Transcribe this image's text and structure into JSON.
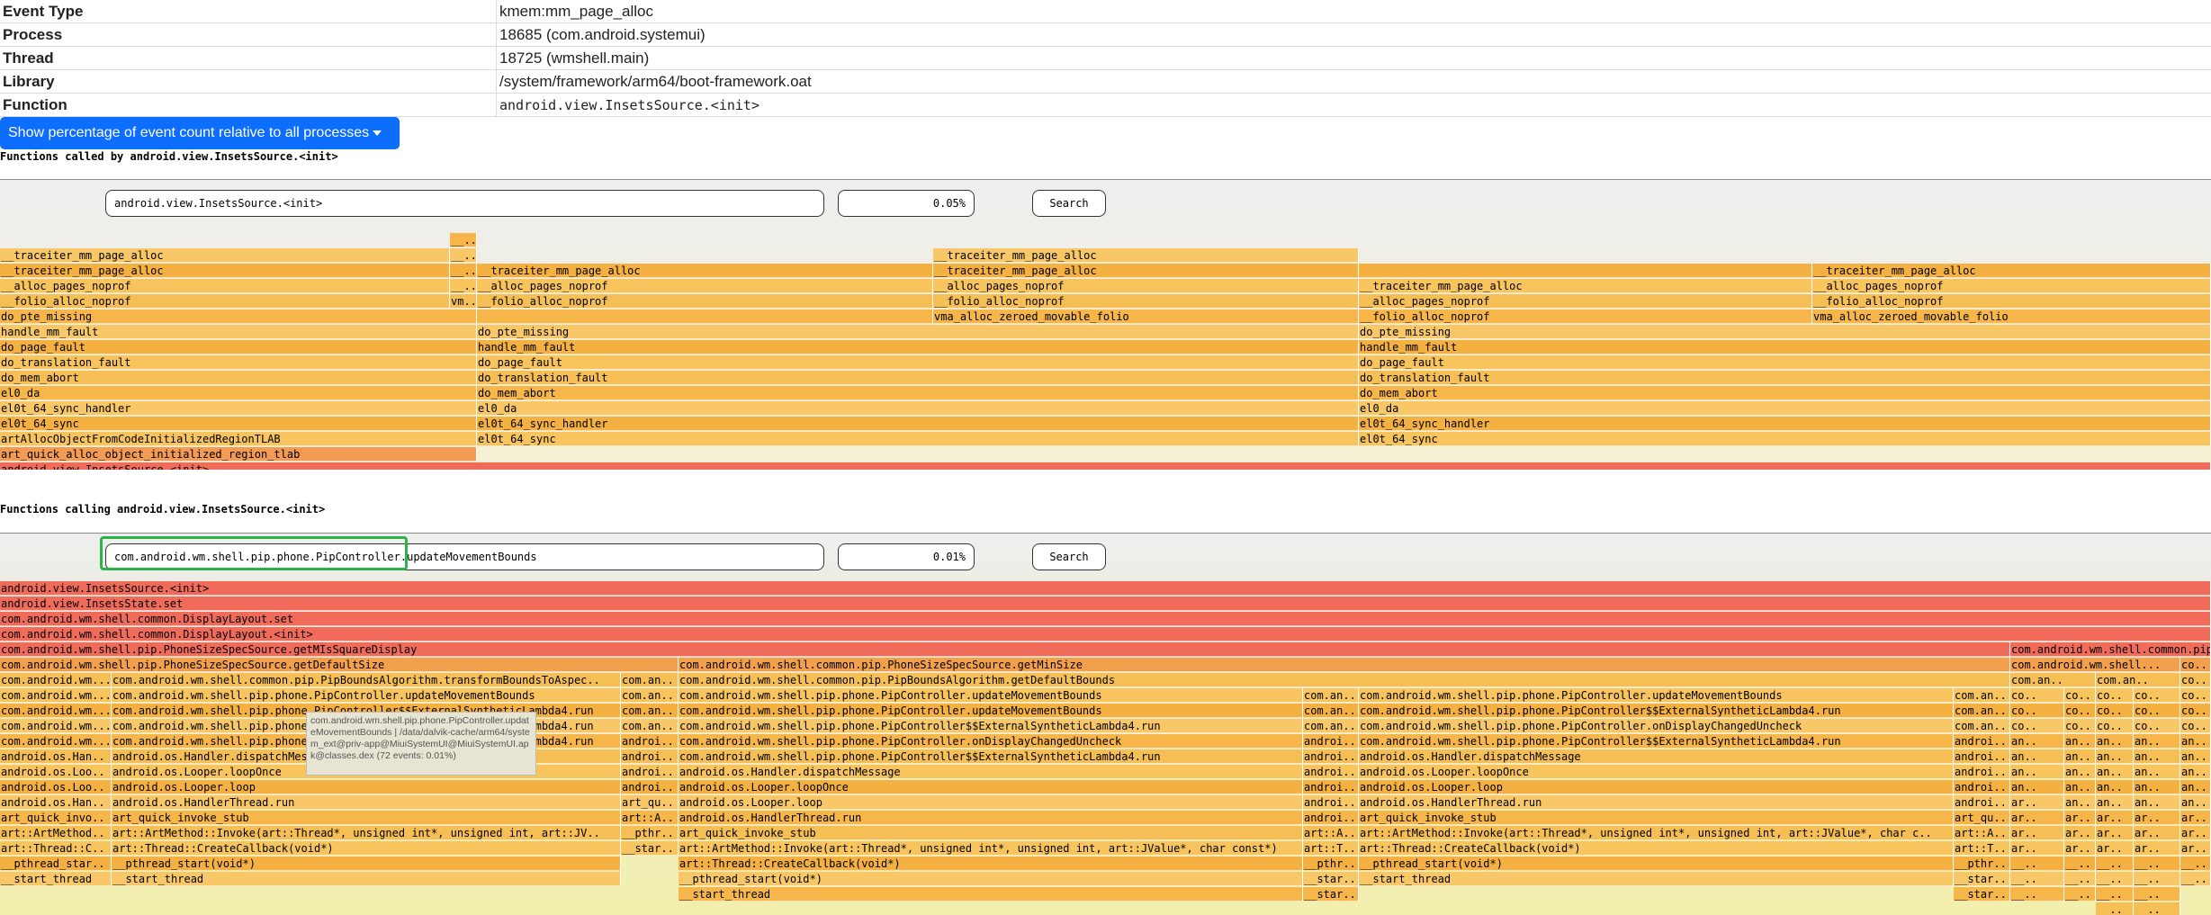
{
  "info": [
    {
      "label": "Event Type",
      "value": "kmem:mm_page_alloc"
    },
    {
      "label": "Process",
      "value": "18685 (com.android.systemui)"
    },
    {
      "label": "Thread",
      "value": "18725 (wmshell.main)"
    },
    {
      "label": "Library",
      "value": "/system/framework/arm64/boot-framework.oat"
    },
    {
      "label": "Function",
      "value": "android.view.InsetsSource.<init>"
    }
  ],
  "toggle_button": "Show percentage of event count relative to all processes",
  "callee": {
    "header": "Functions called by android.view.InsetsSource.<init>",
    "search_value": "android.view.InsetsSource.<init>",
    "percent": "0.05%",
    "search_label": "Search"
  },
  "caller": {
    "header": "Functions calling android.view.InsetsSource.<init>",
    "search_value": "com.android.wm.shell.pip.phone.PipController.updateMovementBounds",
    "percent": "0.01%",
    "search_label": "Search"
  },
  "colors": {
    "accent": "#0d6efd",
    "hot": "#f16b5b",
    "warm": "#f5b041",
    "highlight": "#2eb34a"
  },
  "tooltip": "com.android.wm.shell.pip.phone.PipController.updateMovementBounds | /data/dalvik-cache/arm64/system_ext@priv-app@MiuiSystemUI@MiuiSystemUI.apk@classes.dex (72 events: 0.01%)",
  "flame_top": [
    [
      0,
      1,
      "android.view.InsetsSource.<init>",
      0
    ],
    [
      0,
      0.2156,
      "art_quick_alloc_object_initialized_region_tlab",
      1
    ],
    [
      0.6145,
      1,
      "",
      2
    ],
    [
      0,
      0.2156,
      "artAllocObjectFromCodeInitializedRegionTLAB",
      2
    ],
    [
      0.2156,
      0.6145,
      "el0t_64_sync",
      2
    ],
    [
      0.6145,
      1,
      "el0t_64_sync",
      2
    ],
    [
      0,
      0.2156,
      "el0t_64_sync",
      3
    ],
    [
      0.2156,
      0.6145,
      "el0t_64_sync_handler",
      3
    ],
    [
      0.6145,
      1,
      "el0t_64_sync_handler",
      3
    ],
    [
      0,
      0.2156,
      "el0t_64_sync_handler",
      4
    ],
    [
      0.2156,
      0.6145,
      "el0_da",
      4
    ],
    [
      0.6145,
      1,
      "el0_da",
      4
    ],
    [
      0,
      0.2156,
      "el0_da",
      5
    ],
    [
      0.2156,
      0.6145,
      "do_mem_abort",
      5
    ],
    [
      0.6145,
      1,
      "do_mem_abort",
      5
    ],
    [
      0,
      0.2156,
      "do_mem_abort",
      6
    ],
    [
      0.2156,
      0.6145,
      "do_translation_fault",
      6
    ],
    [
      0.6145,
      1,
      "do_translation_fault",
      6
    ],
    [
      0,
      0.2156,
      "do_translation_fault",
      7
    ],
    [
      0.2156,
      0.6145,
      "do_page_fault",
      7
    ],
    [
      0.6145,
      1,
      "do_page_fault",
      7
    ],
    [
      0,
      0.2156,
      "do_page_fault",
      8
    ],
    [
      0.2156,
      0.6145,
      "handle_mm_fault",
      8
    ],
    [
      0.6145,
      1,
      "handle_mm_fault",
      8
    ],
    [
      0,
      0.2156,
      "handle_mm_fault",
      9
    ],
    [
      0.2156,
      0.6145,
      "do_pte_missing",
      9
    ],
    [
      0.6145,
      1,
      "do_pte_missing",
      9
    ],
    [
      0,
      0.2156,
      "do_pte_missing",
      10
    ],
    [
      0.2156,
      0.4219,
      "",
      10
    ],
    [
      0.4219,
      0.6145,
      "vma_alloc_zeroed_movable_folio",
      10
    ],
    [
      0.6145,
      0.8197,
      "__folio_alloc_noprof",
      10
    ],
    [
      0.8197,
      1,
      "vma_alloc_zeroed_movable_folio",
      10
    ],
    [
      0,
      0.2036,
      "__folio_alloc_noprof",
      11
    ],
    [
      0.2036,
      0.2156,
      "vm..",
      11
    ],
    [
      0.2156,
      0.4219,
      "__folio_alloc_noprof",
      11
    ],
    [
      0.4219,
      0.6145,
      "__folio_alloc_noprof",
      11
    ],
    [
      0.6145,
      0.8197,
      "__alloc_pages_noprof",
      11
    ],
    [
      0.8197,
      1,
      "__folio_alloc_noprof",
      11
    ],
    [
      0,
      0.2036,
      "__alloc_pages_noprof",
      12
    ],
    [
      0.2036,
      0.2156,
      "__..",
      12
    ],
    [
      0.2156,
      0.4219,
      "__alloc_pages_noprof",
      12
    ],
    [
      0.4219,
      0.6145,
      "__alloc_pages_noprof",
      12
    ],
    [
      0.6145,
      0.8197,
      "__traceiter_mm_page_alloc",
      12
    ],
    [
      0.8197,
      1,
      "__alloc_pages_noprof",
      12
    ],
    [
      0,
      0.2036,
      "__traceiter_mm_page_alloc",
      13
    ],
    [
      0.2036,
      0.2156,
      "__..",
      13
    ],
    [
      0.2156,
      0.4219,
      "__traceiter_mm_page_alloc",
      13
    ],
    [
      0.4219,
      0.6145,
      "__traceiter_mm_page_alloc",
      13
    ],
    [
      0.6145,
      0.8197,
      "",
      13
    ],
    [
      0.8197,
      1,
      "__traceiter_mm_page_alloc",
      13
    ],
    [
      0,
      0.2036,
      "__traceiter_mm_page_alloc",
      14
    ],
    [
      0.2036,
      0.2156,
      "__..",
      14
    ],
    [
      0.4219,
      0.6145,
      "__traceiter_mm_page_alloc",
      14
    ],
    [
      0.2036,
      0.2156,
      "__..",
      15
    ]
  ],
  "flame_bottom": [
    [
      0,
      1,
      "android.view.InsetsSource.<init>",
      0
    ],
    [
      0,
      1,
      "android.view.InsetsState.set",
      1
    ],
    [
      0,
      1,
      "com.android.wm.shell.common.DisplayLayout.set",
      2
    ],
    [
      0,
      1,
      "com.android.wm.shell.common.DisplayLayout.<init>",
      3
    ],
    [
      0,
      0.9091,
      "com.android.wm.shell.pip.PhoneSizeSpecSource.getMIsSquareDisplay",
      4
    ],
    [
      0.9091,
      1,
      "com.android.wm.shell.common.pip..",
      4
    ],
    [
      0,
      0.3068,
      "com.android.wm.shell.pip.PhoneSizeSpecSource.getDefaultSize",
      5
    ],
    [
      0.3068,
      0.9091,
      "com.android.wm.shell.common.pip.PhoneSizeSpecSource.getMinSize",
      5
    ],
    [
      0.9091,
      0.986,
      "com.android.wm.shell...",
      5
    ],
    [
      0.986,
      1,
      "co..",
      5
    ],
    [
      0,
      0.0505,
      "com.android.wm...",
      6
    ],
    [
      0.0505,
      0.281,
      "com.android.wm.shell.common.pip.PipBoundsAlgorithm.transformBoundsToAspec..",
      6
    ],
    [
      0.281,
      0.3068,
      "com.an..",
      6
    ],
    [
      0.3068,
      0.9091,
      "com.android.wm.shell.common.pip.PipBoundsAlgorithm.getDefaultBounds",
      6
    ],
    [
      0.9091,
      0.9478,
      "com.an..",
      6
    ],
    [
      0.9478,
      0.986,
      "com.an..",
      6
    ],
    [
      0.986,
      1,
      "co..",
      6
    ],
    [
      0,
      0.0505,
      "com.android.wm...",
      7
    ],
    [
      0.0505,
      0.281,
      "com.android.wm.shell.pip.phone.PipController.updateMovementBounds",
      7
    ],
    [
      0.281,
      0.3068,
      "com.an..",
      7
    ],
    [
      0.3068,
      0.5893,
      "com.android.wm.shell.pip.phone.PipController.updateMovementBounds",
      7
    ],
    [
      0.5893,
      0.6145,
      "com.an..",
      7
    ],
    [
      0.6145,
      0.8835,
      "com.android.wm.shell.pip.phone.PipController.updateMovementBounds",
      7
    ],
    [
      0.8835,
      0.9091,
      "com.an..",
      7
    ],
    [
      0.9091,
      0.9337,
      "co..",
      7
    ],
    [
      0.9337,
      0.9478,
      "co..",
      7
    ],
    [
      0.9478,
      0.9652,
      "co..",
      7
    ],
    [
      0.9652,
      0.986,
      "co..",
      7
    ],
    [
      0.986,
      1,
      "co..",
      7
    ],
    [
      0,
      0.0505,
      "com.android.wm...",
      8
    ],
    [
      0.0505,
      0.281,
      "com.android.wm.shell.pip.phone.PipController$$ExternalSyntheticLambda4.run",
      8
    ],
    [
      0.281,
      0.3068,
      "com.an..",
      8
    ],
    [
      0.3068,
      0.5893,
      "com.android.wm.shell.pip.phone.PipController.updateMovementBounds",
      8
    ],
    [
      0.5893,
      0.6145,
      "com.an..",
      8
    ],
    [
      0.6145,
      0.8835,
      "com.android.wm.shell.pip.phone.PipController$$ExternalSyntheticLambda4.run",
      8
    ],
    [
      0.8835,
      0.9091,
      "com.an..",
      8
    ],
    [
      0.9091,
      0.9337,
      "co..",
      8
    ],
    [
      0.9337,
      0.9478,
      "co..",
      8
    ],
    [
      0.9478,
      0.9652,
      "co..",
      8
    ],
    [
      0.9652,
      0.986,
      "co..",
      8
    ],
    [
      0.986,
      1,
      "co..",
      8
    ],
    [
      0,
      0.0505,
      "com.android.wm...",
      9
    ],
    [
      0.0505,
      0.281,
      "com.android.wm.shell.pip.phone.PipController$$ExternalSyntheticLambda4.run",
      9
    ],
    [
      0.281,
      0.3068,
      "com.an..",
      9
    ],
    [
      0.3068,
      0.5893,
      "com.android.wm.shell.pip.phone.PipController$$ExternalSyntheticLambda4.run",
      9
    ],
    [
      0.5893,
      0.6145,
      "com.an..",
      9
    ],
    [
      0.6145,
      0.8835,
      "com.android.wm.shell.pip.phone.PipController.onDisplayChangedUncheck",
      9
    ],
    [
      0.8835,
      0.9091,
      "com.an..",
      9
    ],
    [
      0.9091,
      0.9337,
      "co..",
      9
    ],
    [
      0.9337,
      0.9478,
      "co..",
      9
    ],
    [
      0.9478,
      0.9652,
      "co..",
      9
    ],
    [
      0.9652,
      0.986,
      "co..",
      9
    ],
    [
      0.986,
      1,
      "co..",
      9
    ],
    [
      0,
      0.0505,
      "com.android.wm...",
      10
    ],
    [
      0.0505,
      0.281,
      "com.android.wm.shell.pip.phone.PipController$$ExternalSyntheticLambda4.run",
      10
    ],
    [
      0.281,
      0.3068,
      "androi..",
      10
    ],
    [
      0.3068,
      0.5893,
      "com.android.wm.shell.pip.phone.PipController.onDisplayChangedUncheck",
      10
    ],
    [
      0.5893,
      0.6145,
      "androi..",
      10
    ],
    [
      0.6145,
      0.8835,
      "com.android.wm.shell.pip.phone.PipController$$ExternalSyntheticLambda4.run",
      10
    ],
    [
      0.8835,
      0.9091,
      "androi..",
      10
    ],
    [
      0.9091,
      0.9337,
      "an..",
      10
    ],
    [
      0.9337,
      0.9478,
      "an..",
      10
    ],
    [
      0.9478,
      0.9652,
      "an..",
      10
    ],
    [
      0.9652,
      0.986,
      "an..",
      10
    ],
    [
      0.986,
      1,
      "an..",
      10
    ],
    [
      0,
      0.0505,
      "android.os.Han..",
      11
    ],
    [
      0.0505,
      0.281,
      "android.os.Handler.dispatchMessage",
      11
    ],
    [
      0.281,
      0.3068,
      "androi..",
      11
    ],
    [
      0.3068,
      0.5893,
      "com.android.wm.shell.pip.phone.PipController$$ExternalSyntheticLambda4.run",
      11
    ],
    [
      0.5893,
      0.6145,
      "androi..",
      11
    ],
    [
      0.6145,
      0.8835,
      "android.os.Handler.dispatchMessage",
      11
    ],
    [
      0.8835,
      0.9091,
      "androi..",
      11
    ],
    [
      0.9091,
      0.9337,
      "an..",
      11
    ],
    [
      0.9337,
      0.9478,
      "an..",
      11
    ],
    [
      0.9478,
      0.9652,
      "an..",
      11
    ],
    [
      0.9652,
      0.986,
      "an..",
      11
    ],
    [
      0.986,
      1,
      "an..",
      11
    ],
    [
      0,
      0.0505,
      "android.os.Loo..",
      12
    ],
    [
      0.0505,
      0.281,
      "android.os.Looper.loopOnce",
      12
    ],
    [
      0.281,
      0.3068,
      "androi..",
      12
    ],
    [
      0.3068,
      0.5893,
      "android.os.Handler.dispatchMessage",
      12
    ],
    [
      0.5893,
      0.6145,
      "androi..",
      12
    ],
    [
      0.6145,
      0.8835,
      "android.os.Looper.loopOnce",
      12
    ],
    [
      0.8835,
      0.9091,
      "androi..",
      12
    ],
    [
      0.9091,
      0.9337,
      "an..",
      12
    ],
    [
      0.9337,
      0.9478,
      "an..",
      12
    ],
    [
      0.9478,
      0.9652,
      "an..",
      12
    ],
    [
      0.9652,
      0.986,
      "an..",
      12
    ],
    [
      0.986,
      1,
      "an..",
      12
    ],
    [
      0,
      0.0505,
      "android.os.Loo..",
      13
    ],
    [
      0.0505,
      0.281,
      "android.os.Looper.loop",
      13
    ],
    [
      0.281,
      0.3068,
      "androi..",
      13
    ],
    [
      0.3068,
      0.5893,
      "android.os.Looper.loopOnce",
      13
    ],
    [
      0.5893,
      0.6145,
      "androi..",
      13
    ],
    [
      0.6145,
      0.8835,
      "android.os.Looper.loop",
      13
    ],
    [
      0.8835,
      0.9091,
      "androi..",
      13
    ],
    [
      0.9091,
      0.9337,
      "an..",
      13
    ],
    [
      0.9337,
      0.9478,
      "an..",
      13
    ],
    [
      0.9478,
      0.9652,
      "an..",
      13
    ],
    [
      0.9652,
      0.986,
      "an..",
      13
    ],
    [
      0.986,
      1,
      "an..",
      13
    ],
    [
      0,
      0.0505,
      "android.os.Han..",
      14
    ],
    [
      0.0505,
      0.281,
      "android.os.HandlerThread.run",
      14
    ],
    [
      0.281,
      0.3068,
      "art_qu..",
      14
    ],
    [
      0.3068,
      0.5893,
      "android.os.Looper.loop",
      14
    ],
    [
      0.5893,
      0.6145,
      "androi..",
      14
    ],
    [
      0.6145,
      0.8835,
      "android.os.HandlerThread.run",
      14
    ],
    [
      0.8835,
      0.9091,
      "androi..",
      14
    ],
    [
      0.9091,
      0.9337,
      "ar..",
      14
    ],
    [
      0.9337,
      0.9478,
      "an..",
      14
    ],
    [
      0.9478,
      0.9652,
      "an..",
      14
    ],
    [
      0.9652,
      0.986,
      "an..",
      14
    ],
    [
      0.986,
      1,
      "an..",
      14
    ],
    [
      0,
      0.0505,
      "art_quick_invo..",
      15
    ],
    [
      0.0505,
      0.281,
      "art_quick_invoke_stub",
      15
    ],
    [
      0.281,
      0.3068,
      "art::A..",
      15
    ],
    [
      0.3068,
      0.5893,
      "android.os.HandlerThread.run",
      15
    ],
    [
      0.5893,
      0.6145,
      "androi..",
      15
    ],
    [
      0.6145,
      0.8835,
      "art_quick_invoke_stub",
      15
    ],
    [
      0.8835,
      0.9091,
      "art_qu..",
      15
    ],
    [
      0.9091,
      0.9337,
      "ar..",
      15
    ],
    [
      0.9337,
      0.9478,
      "ar..",
      15
    ],
    [
      0.9478,
      0.9652,
      "ar..",
      15
    ],
    [
      0.9652,
      0.986,
      "ar..",
      15
    ],
    [
      0.986,
      1,
      "ar..",
      15
    ],
    [
      0,
      0.0505,
      "art::ArtMethod..",
      16
    ],
    [
      0.0505,
      0.281,
      "art::ArtMethod::Invoke(art::Thread*, unsigned int*, unsigned int, art::JV..",
      16
    ],
    [
      0.281,
      0.3068,
      "__pthr..",
      16
    ],
    [
      0.3068,
      0.5893,
      "art_quick_invoke_stub",
      16
    ],
    [
      0.5893,
      0.6145,
      "art::A..",
      16
    ],
    [
      0.6145,
      0.8835,
      "art::ArtMethod::Invoke(art::Thread*, unsigned int*, unsigned int, art::JValue*, char c..",
      16
    ],
    [
      0.8835,
      0.9091,
      "art::A..",
      16
    ],
    [
      0.9091,
      0.9337,
      "ar..",
      16
    ],
    [
      0.9337,
      0.9478,
      "ar..",
      16
    ],
    [
      0.9478,
      0.9652,
      "ar..",
      16
    ],
    [
      0.9652,
      0.986,
      "ar..",
      16
    ],
    [
      0.986,
      1,
      "ar..",
      16
    ],
    [
      0,
      0.0505,
      "art::Thread::C..",
      17
    ],
    [
      0.0505,
      0.281,
      "art::Thread::CreateCallback(void*)",
      17
    ],
    [
      0.281,
      0.3068,
      "__star..",
      17
    ],
    [
      0.3068,
      0.5893,
      "art::ArtMethod::Invoke(art::Thread*, unsigned int*, unsigned int, art::JValue*, char const*)",
      17
    ],
    [
      0.5893,
      0.6145,
      "art::T..",
      17
    ],
    [
      0.6145,
      0.8835,
      "art::Thread::CreateCallback(void*)",
      17
    ],
    [
      0.8835,
      0.9091,
      "art::T..",
      17
    ],
    [
      0.9091,
      0.9337,
      "ar..",
      17
    ],
    [
      0.9337,
      0.9478,
      "ar..",
      17
    ],
    [
      0.9478,
      0.9652,
      "ar..",
      17
    ],
    [
      0.9652,
      0.986,
      "ar..",
      17
    ],
    [
      0.986,
      1,
      "ar..",
      17
    ],
    [
      0,
      0.0505,
      "__pthread_star..",
      18
    ],
    [
      0.0505,
      0.281,
      "__pthread_start(void*)",
      18
    ],
    [
      0.3068,
      0.5893,
      "art::Thread::CreateCallback(void*)",
      18
    ],
    [
      0.5893,
      0.6145,
      "__pthr..",
      18
    ],
    [
      0.6145,
      0.8835,
      "__pthread_start(void*)",
      18
    ],
    [
      0.8835,
      0.9091,
      "__pthr..",
      18
    ],
    [
      0.9091,
      0.9337,
      "__..",
      18
    ],
    [
      0.9337,
      0.9478,
      "__..",
      18
    ],
    [
      0.9478,
      0.9652,
      "__..",
      18
    ],
    [
      0.9652,
      0.986,
      "__..",
      18
    ],
    [
      0.986,
      1,
      "__..",
      18
    ],
    [
      0,
      0.0505,
      "__start_thread",
      19
    ],
    [
      0.0505,
      0.281,
      "__start_thread",
      19
    ],
    [
      0.3068,
      0.5893,
      "__pthread_start(void*)",
      19
    ],
    [
      0.5893,
      0.6145,
      "__star..",
      19
    ],
    [
      0.6145,
      0.8835,
      "__start_thread",
      19
    ],
    [
      0.8835,
      0.9091,
      "__star..",
      19
    ],
    [
      0.9091,
      0.9337,
      "__..",
      19
    ],
    [
      0.9337,
      0.9478,
      "__..",
      19
    ],
    [
      0.9478,
      0.9652,
      "__..",
      19
    ],
    [
      0.9652,
      0.986,
      "__..",
      19
    ],
    [
      0.986,
      1,
      "__..",
      19
    ],
    [
      0.3068,
      0.5893,
      "__start_thread",
      20
    ],
    [
      0.5893,
      0.6145,
      "__star..",
      20
    ],
    [
      0.8835,
      0.9091,
      "__star..",
      20
    ],
    [
      0.9091,
      0.9337,
      "__..",
      20
    ],
    [
      0.9337,
      0.9478,
      "__..",
      20
    ],
    [
      0.9478,
      0.9652,
      "__..",
      20
    ],
    [
      0.9652,
      0.986,
      "__..",
      20
    ],
    [
      0.9478,
      0.9652,
      "__..",
      21
    ],
    [
      0.9652,
      0.986,
      "__..",
      21
    ]
  ]
}
